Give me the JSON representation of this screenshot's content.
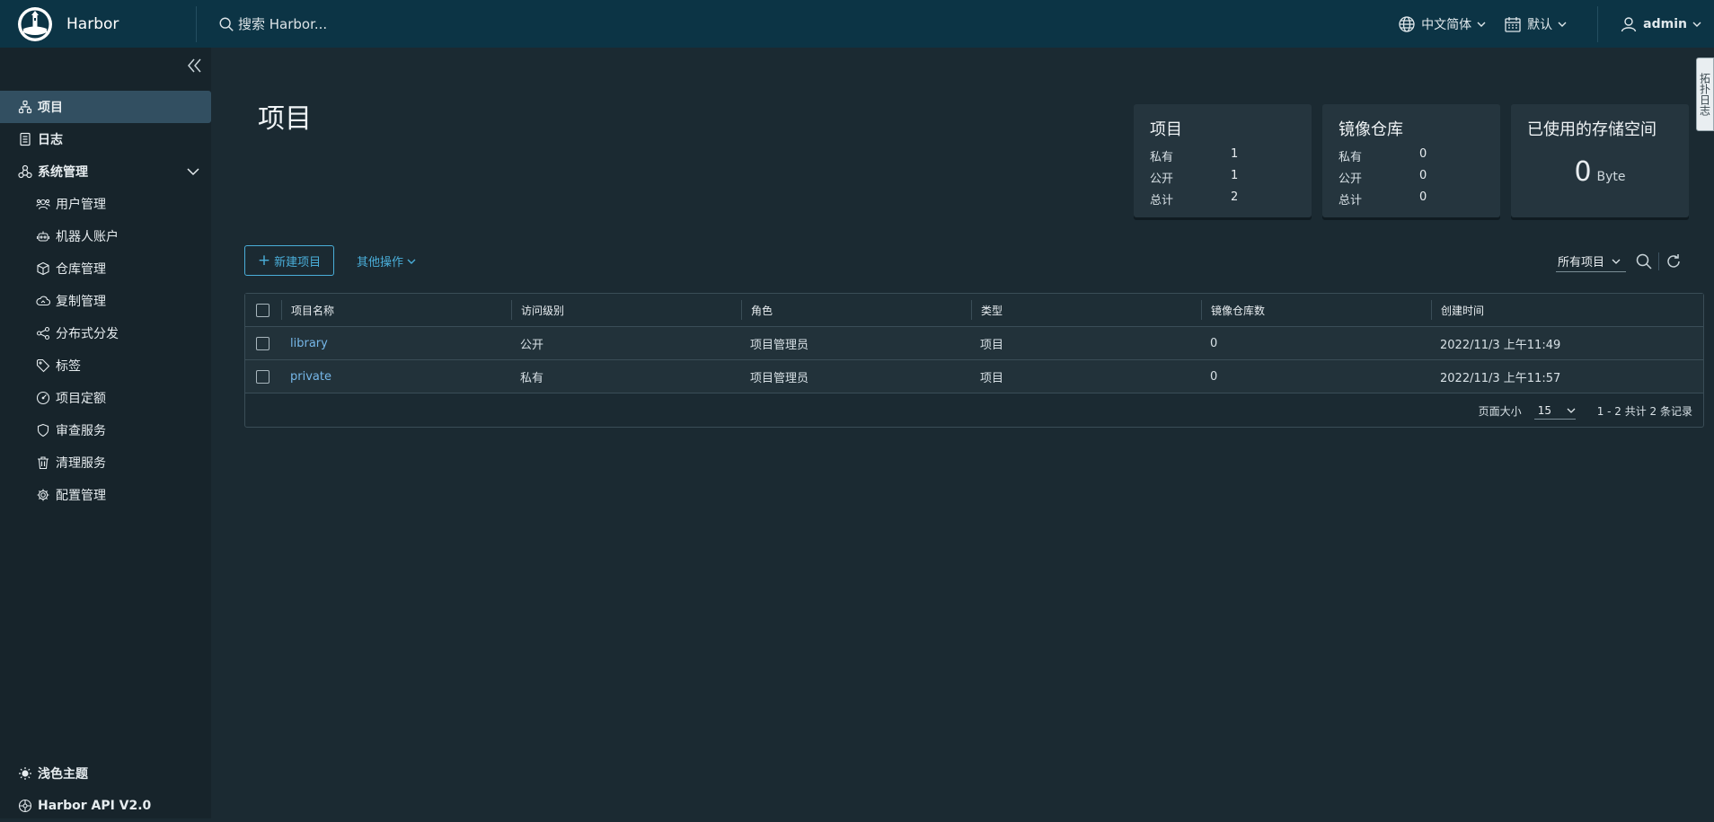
{
  "header": {
    "brand": "Harbor",
    "search_placeholder": "搜索 Harbor...",
    "language": "中文简体",
    "datetime_format": "默认",
    "user": "admin"
  },
  "sidebar": {
    "items": [
      {
        "label": "项目",
        "icon": "projects-icon",
        "level": "top",
        "active": true
      },
      {
        "label": "日志",
        "icon": "logs-icon",
        "level": "top"
      },
      {
        "label": "系统管理",
        "icon": "administration-icon",
        "level": "top",
        "expanded": true
      },
      {
        "label": "用户管理",
        "icon": "users-icon",
        "level": "sub"
      },
      {
        "label": "机器人账户",
        "icon": "robot-icon",
        "level": "sub"
      },
      {
        "label": "仓库管理",
        "icon": "registry-icon",
        "level": "sub"
      },
      {
        "label": "复制管理",
        "icon": "replication-icon",
        "level": "sub"
      },
      {
        "label": "分布式分发",
        "icon": "distribution-icon",
        "level": "sub"
      },
      {
        "label": "标签",
        "icon": "tag-icon",
        "level": "sub"
      },
      {
        "label": "项目定额",
        "icon": "quota-icon",
        "level": "sub"
      },
      {
        "label": "审查服务",
        "icon": "shield-icon",
        "level": "sub"
      },
      {
        "label": "清理服务",
        "icon": "trash-icon",
        "level": "sub"
      },
      {
        "label": "配置管理",
        "icon": "gear-icon",
        "level": "sub"
      }
    ],
    "bottom": {
      "theme_toggle": "浅色主题",
      "api": "Harbor API V2.0"
    }
  },
  "main": {
    "title": "项目",
    "cards": {
      "projects": {
        "title": "项目",
        "private_label": "私有",
        "private": "1",
        "public_label": "公开",
        "public": "1",
        "total_label": "总计",
        "total": "2"
      },
      "repos": {
        "title": "镜像仓库",
        "private_label": "私有",
        "private": "0",
        "public_label": "公开",
        "public": "0",
        "total_label": "总计",
        "total": "0"
      },
      "storage": {
        "title": "已使用的存储空间",
        "value": "0",
        "unit": "Byte"
      }
    },
    "toolbar": {
      "new_project": "新建项目",
      "other_actions": "其他操作",
      "filter_selected": "所有项目"
    },
    "table": {
      "columns": [
        "项目名称",
        "访问级别",
        "角色",
        "类型",
        "镜像仓库数",
        "创建时间"
      ],
      "rows": [
        {
          "name": "library",
          "access": "公开",
          "role": "项目管理员",
          "type": "项目",
          "repo_count": "0",
          "created": "2022/11/3 上午11:49"
        },
        {
          "name": "private",
          "access": "私有",
          "role": "项目管理员",
          "type": "项目",
          "repo_count": "0",
          "created": "2022/11/3 上午11:57"
        }
      ],
      "footer": {
        "page_size_label": "页面大小",
        "page_size": "15",
        "summary": "1 - 2 共计 2 条记录"
      }
    },
    "edge_tab": "拓扑日志"
  },
  "colors": {
    "header_bg": "#0c3445",
    "sidebar_bg": "#17242b",
    "main_bg": "#1b2a32",
    "accent": "#4aaed9",
    "link": "#76b7e8",
    "active_nav": "#324f61"
  }
}
